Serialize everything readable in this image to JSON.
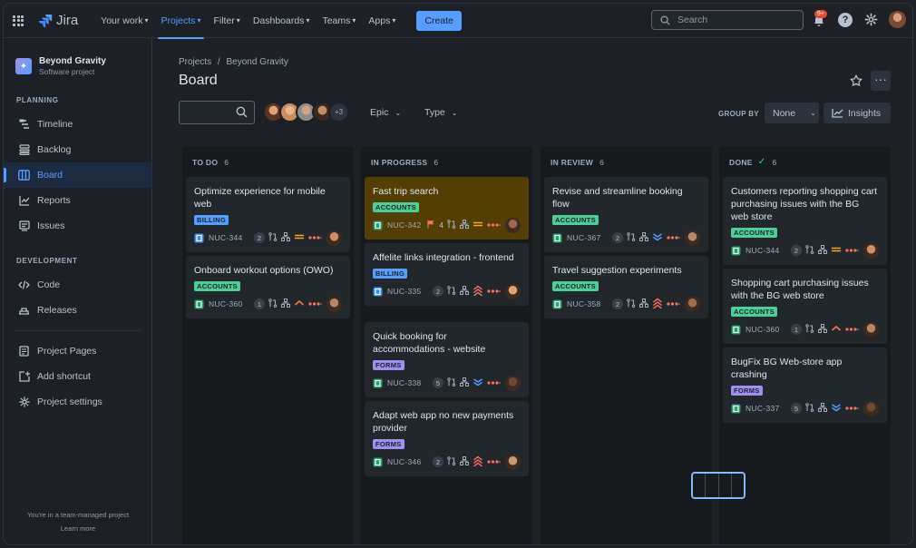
{
  "nav": {
    "brand": "Jira",
    "items": [
      {
        "label": "Your work",
        "active": false
      },
      {
        "label": "Projects",
        "active": true
      },
      {
        "label": "Filter",
        "active": false
      },
      {
        "label": "Dashboards",
        "active": false
      },
      {
        "label": "Teams",
        "active": false
      },
      {
        "label": "Apps",
        "active": false
      }
    ],
    "create_label": "Create",
    "search_placeholder": "Search",
    "notifications_badge": "9+"
  },
  "sidebar": {
    "project_name": "Beyond Gravity",
    "project_type": "Software project",
    "planning_label": "PLANNING",
    "planning_items": [
      {
        "label": "Timeline",
        "icon": "timeline-icon"
      },
      {
        "label": "Backlog",
        "icon": "backlog-icon"
      },
      {
        "label": "Board",
        "icon": "board-icon",
        "active": true
      },
      {
        "label": "Reports",
        "icon": "reports-icon"
      },
      {
        "label": "Issues",
        "icon": "issues-icon"
      }
    ],
    "development_label": "DEVELOPMENT",
    "development_items": [
      {
        "label": "Code",
        "icon": "code-icon"
      },
      {
        "label": "Releases",
        "icon": "releases-icon"
      }
    ],
    "other_items": [
      {
        "label": "Project Pages",
        "icon": "pages-icon"
      },
      {
        "label": "Add shortcut",
        "icon": "add-shortcut-icon"
      },
      {
        "label": "Project settings",
        "icon": "settings-icon"
      }
    ],
    "footer_line1": "You're in a team-managed project",
    "footer_line2": "Learn more"
  },
  "board": {
    "breadcrumb_root": "Projects",
    "breadcrumb_sep": "/",
    "breadcrumb_project": "Beyond Gravity",
    "title": "Board",
    "more_avatars": "+3",
    "filter_epic": "Epic",
    "filter_type": "Type",
    "group_by_label": "GROUP BY",
    "group_by_value": "None",
    "insights_label": "Insights"
  },
  "columns": [
    {
      "name": "TO DO",
      "count": "6",
      "done": false,
      "cards": [
        {
          "title": "Optimize experience for mobile web",
          "tag": "BILLING",
          "key": "NUC-344",
          "count": "2",
          "priority": "medium",
          "avatar": "#c9906a"
        },
        {
          "title": "Onboard workout options (OWO)",
          "tag": "ACCOUNTS",
          "key": "NUC-360",
          "count": "1",
          "priority": "high",
          "avatar": "#b5886a"
        }
      ]
    },
    {
      "name": "IN PROGRESS",
      "count": "6",
      "done": false,
      "cards": [
        {
          "title": "Fast trip search",
          "tag": "ACCOUNTS",
          "key": "NUC-342",
          "count": "4",
          "priority": "medium",
          "flag": true,
          "highlight": true,
          "avatar": "#a0674b"
        },
        {
          "title": "Affelite links integration - frontend",
          "tag": "BILLING",
          "key": "NUC-335",
          "count": "2",
          "priority": "highest",
          "avatar": "#d9a47a"
        },
        {
          "title": "Quick booking for accommodations - website",
          "tag": "FORMS",
          "key": "NUC-338",
          "count": "5",
          "priority": "lowest",
          "avatar": "#6b4a35"
        },
        {
          "title": "Adapt web app no new payments provider",
          "tag": "FORMS",
          "key": "NUC-346",
          "count": "2",
          "priority": "highest",
          "avatar": "#c99a7a"
        }
      ]
    },
    {
      "name": "IN REVIEW",
      "count": "6",
      "done": false,
      "cards": [
        {
          "title": "Revise and streamline booking flow",
          "tag": "ACCOUNTS",
          "key": "NUC-367",
          "count": "2",
          "priority": "lowest",
          "avatar": "#b5886a"
        },
        {
          "title": "Travel suggestion experiments",
          "tag": "ACCOUNTS",
          "key": "NUC-358",
          "count": "2",
          "priority": "highest",
          "avatar": "#9a6f52"
        }
      ]
    },
    {
      "name": "DONE",
      "count": "6",
      "done": true,
      "cards": [
        {
          "title": "Customers reporting shopping cart purchasing issues with the BG web store",
          "tag": "ACCOUNTS",
          "key": "NUC-344",
          "count": "2",
          "priority": "medium",
          "avatar": "#c9906a"
        },
        {
          "title": "Shopping cart purchasing issues with the BG web store",
          "tag": "ACCOUNTS",
          "key": "NUC-360",
          "count": "1",
          "priority": "high",
          "avatar": "#b5886a"
        },
        {
          "title": "BugFix BG Web-store app crashing",
          "tag": "FORMS",
          "key": "NUC-337",
          "count": "5",
          "priority": "lowest",
          "avatar": "#6b4a35"
        }
      ]
    }
  ],
  "colors": {
    "accent": "#579dff",
    "tag_billing": "#579dff",
    "tag_accounts": "#4bce97",
    "tag_forms": "#9f8fef",
    "priority_up": "#f87462",
    "priority_medium": "#f5a623",
    "priority_down": "#579dff",
    "done_check": "#4bce97"
  }
}
